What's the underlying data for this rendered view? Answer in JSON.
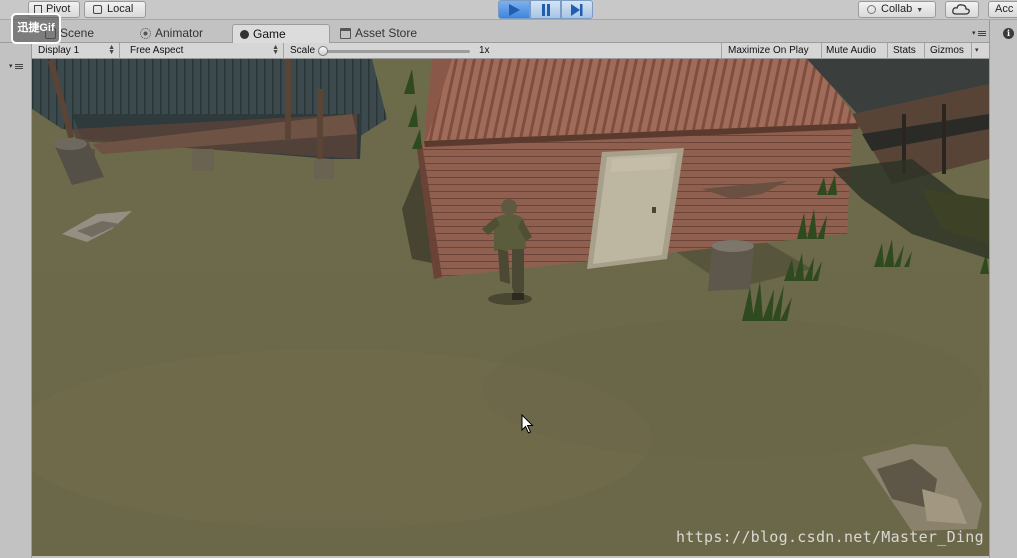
{
  "toolbar": {
    "pivot_label": "Pivot",
    "local_label": "Local",
    "collab_label": "Collab",
    "account_label": "Acc"
  },
  "tabs": [
    {
      "label": "Scene",
      "icon": "scene-icon",
      "active": false
    },
    {
      "label": "Animator",
      "icon": "animator-icon",
      "active": false
    },
    {
      "label": "Game",
      "icon": "game-icon",
      "active": true
    },
    {
      "label": "Asset Store",
      "icon": "asset-store-icon",
      "active": false
    }
  ],
  "game_toolbar": {
    "display": "Display 1",
    "aspect": "Free Aspect",
    "scale_label": "Scale",
    "scale_value": "1x",
    "maximize_on_play": "Maximize On Play",
    "mute_audio": "Mute Audio",
    "stats": "Stats",
    "gizmos": "Gizmos"
  },
  "play_controls": {
    "play_active": true,
    "icons": [
      "play-icon",
      "pause-icon",
      "step-icon"
    ]
  },
  "watermarks": {
    "badge": "迅捷Gif",
    "url": "https://blog.csdn.net/Master_Ding"
  },
  "colors": {
    "play_accent": "#3e85de",
    "ground": "#6f6a4a",
    "shed_wall": "#8a5a4c",
    "roof": "#9a6a58"
  }
}
